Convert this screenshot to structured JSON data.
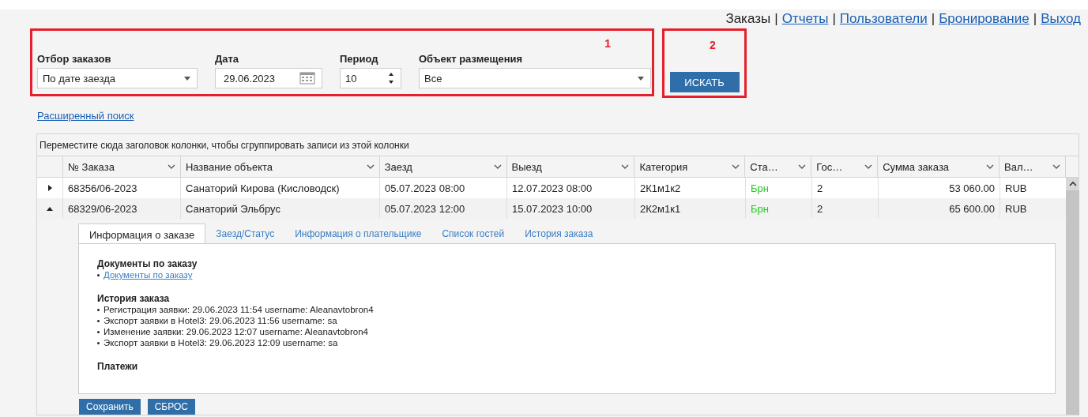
{
  "nav": [
    {
      "label": "Заказы",
      "selected": true
    },
    {
      "label": "Отчеты",
      "selected": false,
      "separator": "|"
    },
    {
      "label": "Пользователи",
      "selected": false,
      "separator": "|"
    },
    {
      "label": "Бронирование",
      "selected": false,
      "separator": "|"
    },
    {
      "label": "Выход",
      "selected": false,
      "separator": "|"
    }
  ],
  "filters": {
    "annotation": "1",
    "order_selection": {
      "label": "Отбор заказов",
      "value": "По дате заезда"
    },
    "date": {
      "label": "Дата",
      "value": "29.06.2023"
    },
    "period": {
      "label": "Период",
      "value": "10"
    },
    "object": {
      "label": "Объект размещения",
      "value": "Все"
    }
  },
  "search": {
    "annotation": "2",
    "button": "ИСКАТЬ"
  },
  "advanced_search_link": "Расширенный поиск",
  "grid": {
    "group_hint": "Переместите сюда заголовок колонки, чтобы сгруппировать записи из этой колонки",
    "columns": [
      "№ Заказа",
      "Название объекта",
      "Заезд",
      "Выезд",
      "Категория",
      "Ста…",
      "Гос…",
      "Сумма заказа",
      "Вал…"
    ],
    "rows": [
      {
        "expanded": false,
        "order": "68356/06-2023",
        "object": "Санаторий Кирова (Кисловодск)",
        "check_in": "05.07.2023 08:00",
        "check_out": "12.07.2023 08:00",
        "category": "2К1м1к2",
        "status": "Брн",
        "guests": "2",
        "amount": "53 060.00",
        "currency": "RUB"
      },
      {
        "expanded": true,
        "order": "68329/06-2023",
        "object": "Санаторий Эльбрус",
        "check_in": "05.07.2023 12:00",
        "check_out": "15.07.2023 10:00",
        "category": "2К2м1к1",
        "status": "Брн",
        "guests": "2",
        "amount": "65 600.00",
        "currency": "RUB",
        "detail": {
          "tabs": [
            {
              "label": "Информация о заказе",
              "selected": true
            },
            {
              "label": "Заезд/Статус",
              "selected": false
            },
            {
              "label": "Информация о плательщике",
              "selected": false
            },
            {
              "label": "Список гостей",
              "selected": false
            },
            {
              "label": "История заказа",
              "selected": false
            }
          ],
          "documents": {
            "title": "Документы по заказу",
            "links": [
              "Документы по заказу"
            ]
          },
          "history": {
            "title": "История заказа",
            "items": [
              "Регистрация заявки: 29.06.2023 11:54 username: Aleanavtobron4",
              "Экспорт заявки в Hotel3: 29.06.2023 11:56 username: sa",
              "Изменение заявки: 29.06.2023 12:07 username: Aleanavtobron4",
              "Экспорт заявки в Hotel3: 29.06.2023 12:09 username: sa"
            ]
          },
          "payments": {
            "title": "Платежи"
          },
          "buttons": [
            "Сохранить",
            "СБРОС"
          ]
        }
      }
    ]
  }
}
